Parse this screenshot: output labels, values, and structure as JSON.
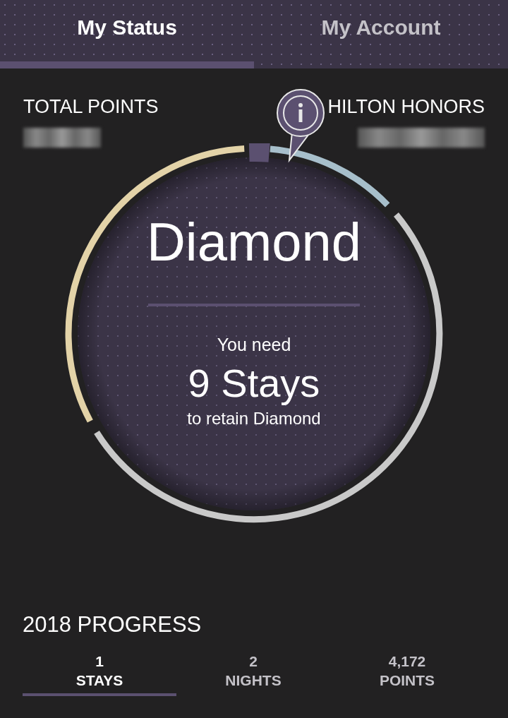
{
  "tabs": [
    {
      "label": "My Status",
      "selected": true
    },
    {
      "label": "My Account",
      "selected": false
    }
  ],
  "summary": {
    "left_label": "TOTAL POINTS",
    "right_label": "HILTON HONORS"
  },
  "status": {
    "tier": "Diamond",
    "line_1": "You need",
    "line_2": "9 Stays",
    "line_3": "to retain Diamond"
  },
  "progress": {
    "title": "2018 PROGRESS",
    "stats": [
      {
        "value": "1",
        "label": "STAYS",
        "selected": true
      },
      {
        "value": "2",
        "label": "NIGHTS",
        "selected": false
      },
      {
        "value": "4,172",
        "label": "POINTS",
        "selected": false
      }
    ]
  }
}
